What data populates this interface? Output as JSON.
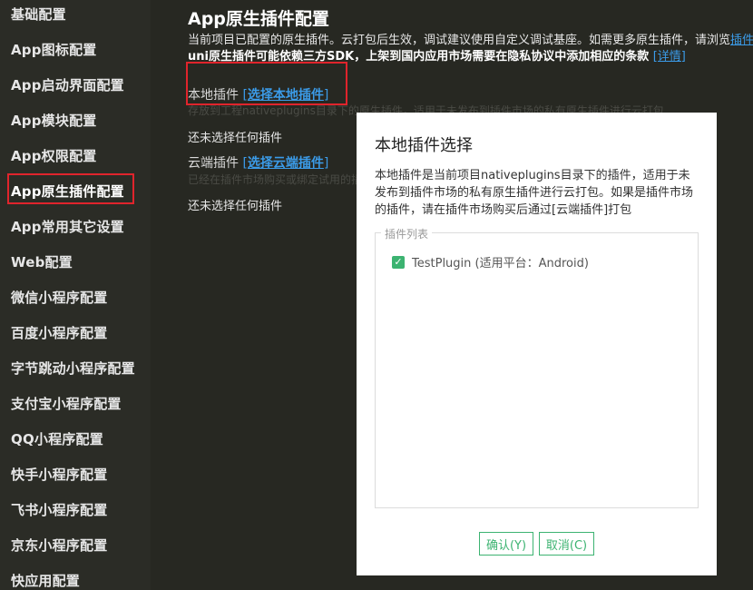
{
  "sidebar": {
    "items": [
      {
        "label": "基础配置"
      },
      {
        "label": "App图标配置"
      },
      {
        "label": "App启动界面配置"
      },
      {
        "label": "App模块配置"
      },
      {
        "label": "App权限配置"
      },
      {
        "label": "App原生插件配置"
      },
      {
        "label": "App常用其它设置"
      },
      {
        "label": "Web配置"
      },
      {
        "label": "微信小程序配置"
      },
      {
        "label": "百度小程序配置"
      },
      {
        "label": "字节跳动小程序配置"
      },
      {
        "label": "支付宝小程序配置"
      },
      {
        "label": "QQ小程序配置"
      },
      {
        "label": "快手小程序配置"
      },
      {
        "label": "飞书小程序配置"
      },
      {
        "label": "京东小程序配置"
      },
      {
        "label": "快应用配置"
      }
    ],
    "active_index": 5
  },
  "main": {
    "title": "App原生插件配置",
    "desc_line1": "当前项目已配置的原生插件。云打包后生效，调试建议使用自定义调试基座。如需更多原生插件，请浏览",
    "desc_line1_link": "插件",
    "desc_line2": "uni原生插件可能依赖三方SDK，上架到国内应用市场需要在隐私协议中添加相应的条款",
    "desc_line2_link": "[详情]",
    "local": {
      "label": "本地插件",
      "bracket_open": "[",
      "link": "选择本地插件",
      "bracket_close": "]",
      "hint": "存放到工程nativeplugins目录下的原生插件，适用于未发布到插件市场的私有原生插件进行云打包",
      "status": "还未选择任何插件"
    },
    "cloud": {
      "label": "云端插件",
      "bracket_open": "[",
      "link": "选择云端插件",
      "bracket_close": "]",
      "hint": "已经在插件市场购买或绑定试用的插",
      "status": "还未选择任何插件"
    }
  },
  "dialog": {
    "title": "本地插件选择",
    "description": "本地插件是当前项目nativeplugins目录下的插件，适用于未发布到插件市场的私有原生插件进行云打包。如果是插件市场的插件，请在插件市场购买后通过[云端插件]打包",
    "list_legend": "插件列表",
    "plugins": [
      {
        "label": "TestPlugin (适用平台：Android)",
        "checked": true
      }
    ],
    "ok_label": "确认(Y)",
    "cancel_label": "取消(C)"
  },
  "colors": {
    "background": "#272822",
    "accent_link": "#3b9be8",
    "highlight_red": "#e0242c",
    "button_green": "#3cb371"
  }
}
